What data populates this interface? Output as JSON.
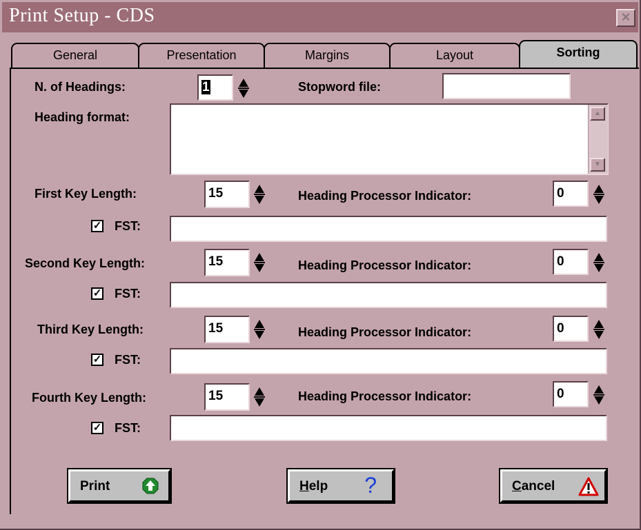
{
  "window": {
    "title": "Print Setup - CDS",
    "close_glyph": "×"
  },
  "tabs": [
    {
      "label": "General"
    },
    {
      "label": "Presentation"
    },
    {
      "label": "Margins"
    },
    {
      "label": "Layout"
    },
    {
      "label": "Sorting",
      "active": true
    }
  ],
  "form": {
    "num_headings_label": "N. of Headings:",
    "num_headings_value": "1",
    "stopword_label": "Stopword file:",
    "stopword_value": "",
    "heading_format_label": "Heading format:",
    "heading_format_value": "",
    "hpi_label": "Heading Processor Indicator:",
    "fst_label": "FST:",
    "check_glyph": "✓",
    "keys": [
      {
        "label": "First Key Length:",
        "length": "15",
        "hpi": "0",
        "fst_checked": true,
        "fst": ""
      },
      {
        "label": "Second Key Length:",
        "length": "15",
        "hpi": "0",
        "fst_checked": true,
        "fst": ""
      },
      {
        "label": "Third Key Length:",
        "length": "15",
        "hpi": "0",
        "fst_checked": true,
        "fst": ""
      },
      {
        "label": "Fourth Key Length:",
        "length": "15",
        "hpi": "0",
        "fst_checked": true,
        "fst": ""
      }
    ]
  },
  "buttons": {
    "print": {
      "label": "Print",
      "icon": "green-up-arrow-icon"
    },
    "help": {
      "first": "H",
      "rest": "elp",
      "icon": "blue-question-icon",
      "glyph": "?"
    },
    "cancel": {
      "first": "C",
      "rest": "ancel",
      "icon": "warning-triangle-icon",
      "glyph": "!"
    }
  },
  "colors": {
    "face": "#c4a4ac",
    "titlebar": "#9c6d77",
    "active_tab": "#c0c0c0"
  }
}
